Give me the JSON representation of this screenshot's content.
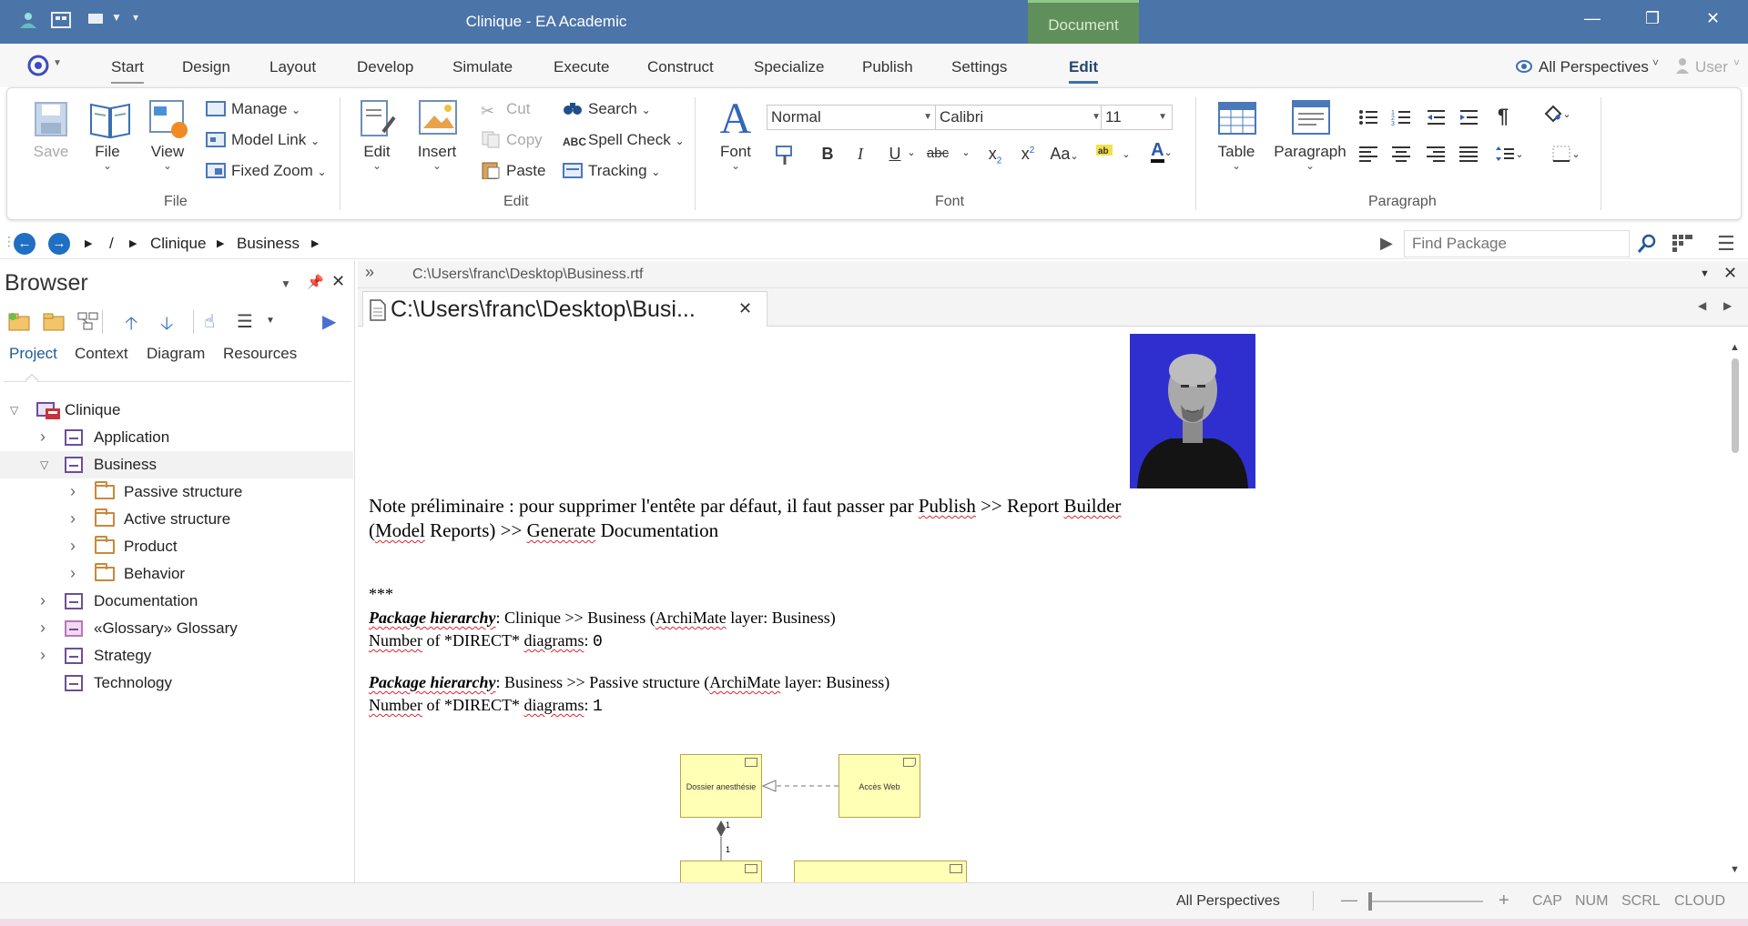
{
  "window": {
    "title": "Clinique - EA Academic",
    "context_tab": "Document",
    "minimize": "—",
    "restore": "❐",
    "close": "✕"
  },
  "menu": {
    "tabs": [
      "Start",
      "Design",
      "Layout",
      "Develop",
      "Simulate",
      "Execute",
      "Construct",
      "Specialize",
      "Publish",
      "Settings",
      "Edit"
    ],
    "active": "Edit",
    "perspectives": "All Perspectives",
    "user": "User"
  },
  "ribbon": {
    "file_group": {
      "label": "File",
      "save": "Save",
      "file": "File",
      "view": "View",
      "manage": "Manage",
      "model_link": "Model Link",
      "fixed_zoom": "Fixed Zoom"
    },
    "edit_group": {
      "label": "Edit",
      "edit": "Edit",
      "insert": "Insert",
      "cut": "Cut",
      "copy": "Copy",
      "paste": "Paste",
      "search": "Search",
      "spell_check": "Spell Check",
      "tracking": "Tracking"
    },
    "font_group": {
      "label": "Font",
      "font": "Font",
      "style_value": "Normal",
      "font_value": "Calibri",
      "size_value": "11"
    },
    "paragraph_group": {
      "label": "Paragraph",
      "table": "Table",
      "paragraph": "Paragraph"
    }
  },
  "pathbar": {
    "root": "/",
    "items": [
      "Clinique",
      "Business"
    ],
    "find_placeholder": "Find Package"
  },
  "browser": {
    "title": "Browser",
    "tabs": [
      "Project",
      "Context",
      "Diagram",
      "Resources"
    ],
    "active_tab": "Project",
    "tree": [
      {
        "label": "Clinique",
        "level": 0,
        "kind": "root",
        "expanded": true
      },
      {
        "label": "Application",
        "level": 1,
        "kind": "package",
        "expanded": false
      },
      {
        "label": "Business",
        "level": 1,
        "kind": "package",
        "expanded": true,
        "selected": true
      },
      {
        "label": "Passive structure",
        "level": 2,
        "kind": "folder",
        "expanded": false
      },
      {
        "label": "Active structure",
        "level": 2,
        "kind": "folder",
        "expanded": false
      },
      {
        "label": "Product",
        "level": 2,
        "kind": "folder",
        "expanded": false
      },
      {
        "label": "Behavior",
        "level": 2,
        "kind": "folder",
        "expanded": false
      },
      {
        "label": "Documentation",
        "level": 1,
        "kind": "package",
        "expanded": false
      },
      {
        "label": "«Glossary» Glossary",
        "level": 1,
        "kind": "glossary",
        "expanded": false
      },
      {
        "label": "Strategy",
        "level": 1,
        "kind": "package",
        "expanded": false
      },
      {
        "label": "Technology",
        "level": 1,
        "kind": "package",
        "expanded": false,
        "noarrow": true
      }
    ]
  },
  "document": {
    "header_path": "C:\\Users\\franc\\Desktop\\Business.rtf",
    "tab_title": "C:\\Users\\franc\\Desktop\\Busi...",
    "note_line1_a": "Note préliminaire : pour supprimer l'entête par défaut, il faut passer par ",
    "note_line1_publish": "Publish",
    "note_line1_b": " >> Report ",
    "note_line1_builder": "Builder",
    "note_line2_a": "(",
    "note_line2_model": "Model",
    "note_line2_b": " Reports) >> ",
    "note_line2_generate": "Generate",
    "note_line2_c": " Documentation",
    "stars": "***",
    "sections": [
      {
        "label": "Package hierarchy",
        "text": ": Clinique >> Business (",
        "archimate": "ArchiMate",
        "text2": " layer: Business)",
        "count_label_a": "Number",
        "count_label_b": " of *DIRECT* ",
        "count_label_c": "diagrams",
        "count": "0"
      },
      {
        "label": "Package hierarchy",
        "text": ": Business >> Passive structure (",
        "archimate": "ArchiMate",
        "text2": " layer: Business)",
        "count_label_a": "Number",
        "count_label_b": " of *DIRECT* ",
        "count_label_c": "diagrams",
        "count": "1"
      }
    ],
    "diagram": {
      "box1": "Dossier anesthésie",
      "box2": "Accès Web",
      "mult1": "1",
      "mult2": "1"
    }
  },
  "status": {
    "perspectives": "All Perspectives",
    "cap": "CAP",
    "num": "NUM",
    "scrl": "SCRL",
    "cloud": "CLOUD",
    "minus": "—",
    "plus": "+"
  },
  "colors": {
    "titlebar": "#4b74a8",
    "context_tab": "#5f8f5a",
    "accent": "#3c6fb0",
    "photo_bg": "#3333cc",
    "uml_fill": "#ffffb5"
  }
}
